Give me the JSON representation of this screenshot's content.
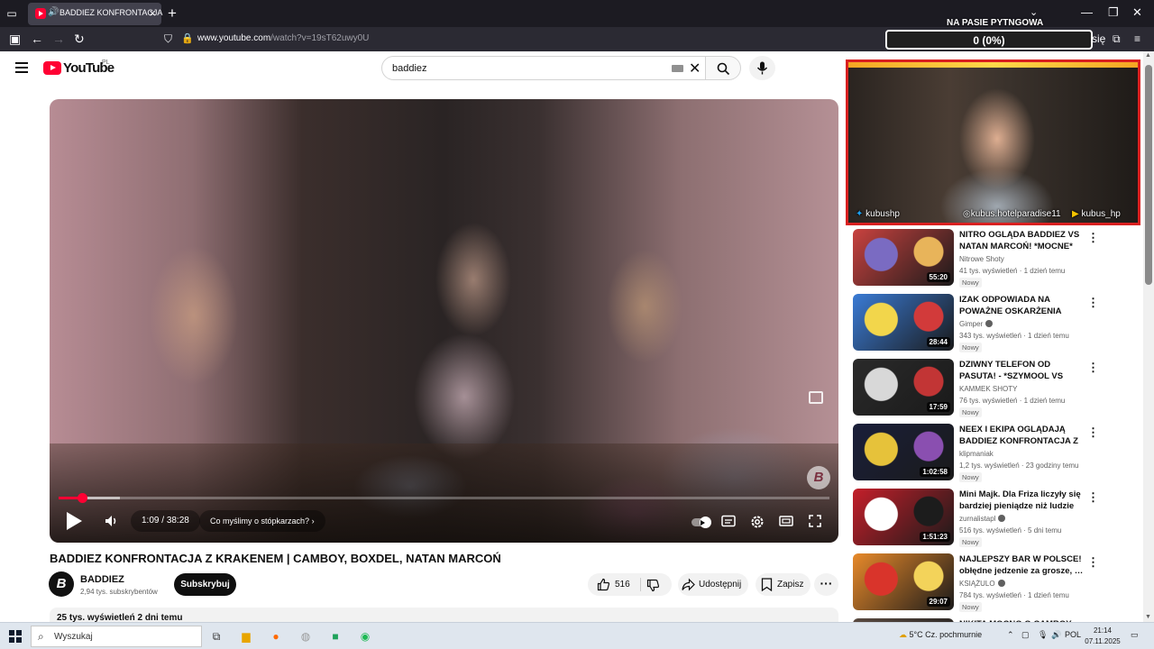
{
  "browser": {
    "tab_title": "BADDIEZ KONFRONTACJA",
    "url_host": "www.youtube.com",
    "url_path": "/watch?v=19sT62uwy0U"
  },
  "overlay": {
    "title": "NA PASIE PYTNGOWA",
    "progress_text": "0 (0%)",
    "progress_value": 0,
    "side_text": "się"
  },
  "youtube": {
    "logo_text": "YouTube",
    "country_code": "PL",
    "search_value": "baddiez"
  },
  "player": {
    "current_time": "1:09",
    "duration": "38:28",
    "time_separator": "/",
    "chapter": "Co myślimy o stópkarzach?",
    "progress_played": 0.03,
    "progress_buffered": 0.08,
    "watermark": "B"
  },
  "video": {
    "title": "BADDIEZ KONFRONTACJA Z KRAKENEM | CAMBOY, BOXDEL, NATAN MARCOŃ",
    "channel_initial": "B",
    "channel_name": "BADDIEZ",
    "channel_subs": "2,94 tys. subskrybentów",
    "subscribe_label": "Subskrybuj",
    "like_count": "516",
    "share_label": "Udostępnij",
    "save_label": "Zapisz",
    "more_label": "···",
    "views_date": "25 tys. wyświetleń  2 dni temu"
  },
  "webcam": {
    "socials": [
      "kubushp",
      "kubus.hotelparadise11",
      "kubus_hp"
    ]
  },
  "recommendations": [
    {
      "title": "NITRO OGLĄDA BADDIEZ VS NATAN MARCOŃ! *MOCNE*",
      "channel": "Nitrowe Shoty",
      "verified": false,
      "meta": "41 tys. wyświetleń · 1 dzień temu",
      "badge": "Nowy",
      "duration": "55:20",
      "thumb_colors": [
        "#c9423f",
        "#7a6bc2",
        "#e8b45a"
      ]
    },
    {
      "title": "IZAK ODPOWIADA NA POWAŻNE OSKARŻENIA",
      "channel": "Gimper",
      "verified": true,
      "meta": "343 tys. wyświetleń · 1 dzień temu",
      "badge": "Nowy",
      "duration": "28:44",
      "thumb_colors": [
        "#3a7bd5",
        "#f2d64b",
        "#d23a3a"
      ]
    },
    {
      "title": "DZIWNY TELEFON OD PASUTA! - *SZYMOOL VS BOJAN* FAM…",
      "channel": "KAMMEK SHOTY",
      "verified": false,
      "meta": "76 tys. wyświetleń · 1 dzień temu",
      "badge": "Nowy",
      "duration": "17:59",
      "thumb_colors": [
        "#2a2a2a",
        "#d8d8d8",
        "#c23535"
      ]
    },
    {
      "title": "NEEX I EKIPA OGLĄDAJĄ BADDIEZ KONFRONTACJA Z …",
      "channel": "klipmaniak",
      "verified": false,
      "meta": "1,2 tys. wyświetleń · 23 godziny temu",
      "badge": "Nowy",
      "duration": "1:02:58",
      "thumb_colors": [
        "#1a1f3a",
        "#e6c23a",
        "#8a4fb0"
      ]
    },
    {
      "title": "Mini Majk. Dla Friza liczyły się bardziej pieniądze niż ludzie",
      "channel": "zurnalistapl",
      "verified": true,
      "meta": "516 tys. wyświetleń · 5 dni temu",
      "badge": "Nowy",
      "duration": "1:51:23",
      "thumb_colors": [
        "#c41f2a",
        "#ffffff",
        "#1c1c1c"
      ]
    },
    {
      "title": "NAJLEPSZY BAR W POLSCE! obłędne jedzenie za grosze, …",
      "channel": "KSIĄŻULO",
      "verified": true,
      "meta": "784 tys. wyświetleń · 1 dzień temu",
      "badge": "Nowy",
      "duration": "29:07",
      "thumb_colors": [
        "#e88a2a",
        "#d9342b",
        "#f3d35a"
      ]
    },
    {
      "title": "NIKITA MOCNO O CAMBOY…",
      "channel": "",
      "verified": false,
      "meta": "",
      "badge": "",
      "duration": "",
      "thumb_colors": [
        "#5a4a40",
        "#c9b49a",
        "#3a3a3a"
      ]
    }
  ],
  "taskbar": {
    "search_placeholder": "Wyszukaj",
    "weather": "5°C  Cz. pochmurnie",
    "language": "POL",
    "time": "21:14",
    "date": "07.11.2025"
  },
  "colors": {
    "accent": "#ff0033",
    "browser_bg": "#1c1b22",
    "webcam_border": "#d92020"
  }
}
